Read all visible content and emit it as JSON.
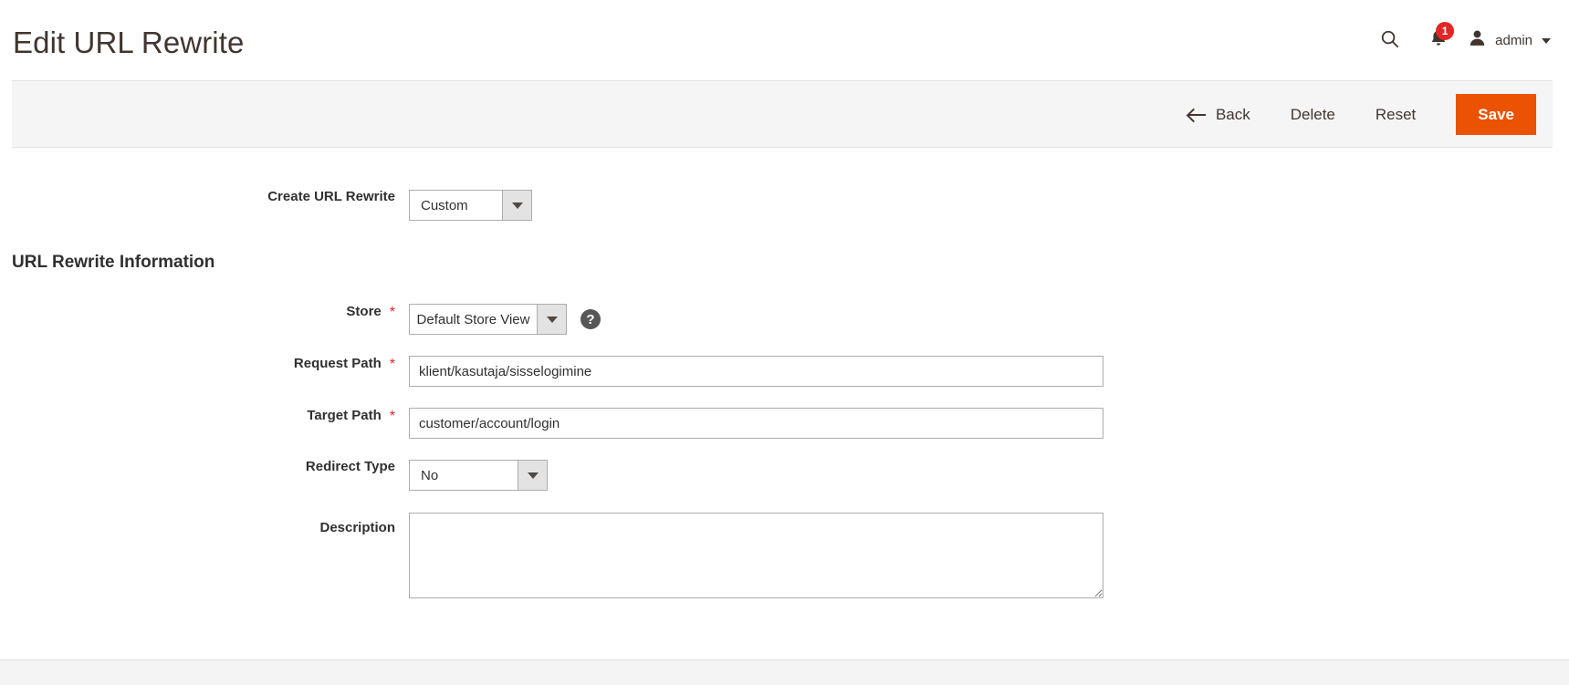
{
  "header": {
    "title": "Edit URL Rewrite",
    "search_icon": "search-icon",
    "notifications_icon": "bell-icon",
    "notifications_count": "1",
    "user_icon": "user-avatar-icon",
    "user_name": "admin",
    "user_caret_icon": "chevron-down-icon"
  },
  "toolbar": {
    "back_label": "Back",
    "back_icon": "arrow-left-icon",
    "delete_label": "Delete",
    "reset_label": "Reset",
    "save_label": "Save",
    "save_color": "#eb5202"
  },
  "form": {
    "create_rewrite": {
      "label": "Create URL Rewrite",
      "value": "Custom",
      "arrow_icon": "caret-down-icon"
    },
    "section_heading": "URL Rewrite Information",
    "store": {
      "label": "Store",
      "required_marker": "*",
      "value": "Default Store View",
      "arrow_icon": "caret-down-icon",
      "help_icon_glyph": "?"
    },
    "request_path": {
      "label": "Request Path",
      "required_marker": "*",
      "value": "klient/kasutaja/sisselogimine",
      "placeholder": ""
    },
    "target_path": {
      "label": "Target Path",
      "required_marker": "*",
      "value": "customer/account/login",
      "placeholder": ""
    },
    "redirect_type": {
      "label": "Redirect Type",
      "value": "No",
      "arrow_icon": "caret-down-icon"
    },
    "description": {
      "label": "Description",
      "value": "",
      "placeholder": ""
    }
  }
}
